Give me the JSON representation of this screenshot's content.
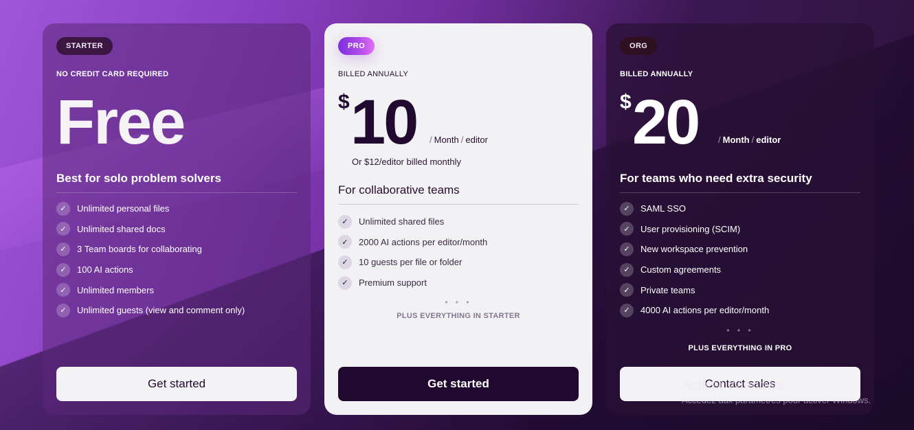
{
  "plans": {
    "starter": {
      "badge": "STARTER",
      "eyebrow": "NO CREDIT CARD REQUIRED",
      "price": "Free",
      "tagline": "Best for solo problem solvers",
      "features": [
        "Unlimited personal files",
        "Unlimited shared docs",
        "3 Team boards for collaborating",
        "100 AI actions",
        "Unlimited members",
        "Unlimited guests (view and comment only)"
      ],
      "cta": "Get started"
    },
    "pro": {
      "badge": "PRO",
      "eyebrow": "BILLED ANNUALLY",
      "currency": "$",
      "amount": "10",
      "period": "Month",
      "unit": "editor",
      "alt_price": "Or $12/editor billed monthly",
      "tagline": "For collaborative teams",
      "features": [
        "Unlimited shared files",
        "2000 AI actions per editor/month",
        "10 guests per file or folder",
        "Premium support"
      ],
      "dots": "• • •",
      "plus": "PLUS EVERYTHING IN STARTER",
      "cta": "Get started"
    },
    "org": {
      "badge": "ORG",
      "eyebrow": "BILLED ANNUALLY",
      "currency": "$",
      "amount": "20",
      "period": "Month",
      "unit": "editor",
      "tagline": "For teams who need extra security",
      "features": [
        "SAML SSO",
        "User provisioning (SCIM)",
        "New workspace prevention",
        "Custom agreements",
        "Private teams",
        "4000 AI actions per editor/month"
      ],
      "dots": "• • •",
      "plus": "PLUS EVERYTHING IN PRO",
      "cta": "Contact sales"
    }
  },
  "separator": "/",
  "check_icon": "✓",
  "watermark": {
    "title": "Activer Windows",
    "subtitle": "Accédez aux paramètres pour activer Windows."
  }
}
